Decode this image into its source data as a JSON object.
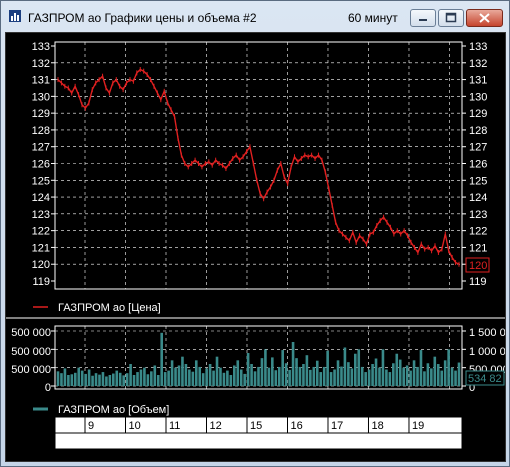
{
  "window": {
    "title": "ГАЗПРОМ ао Графики цены и объема #2",
    "interval": "60 минут"
  },
  "colors": {
    "price": "#e02020",
    "volume": "#3a8a8a",
    "grid": "#ffffff",
    "axis_text": "#ffffff"
  },
  "price_panel": {
    "legend": "ГАЗПРОМ ао [Цена]",
    "last_price_label": "120"
  },
  "volume_panel": {
    "legend": "ГАЗПРОМ ао [Объем]",
    "left_labels": [
      "500 000",
      "500 000",
      "500 000",
      "0"
    ],
    "right_labels": [
      "1 500 000",
      "1 000 000",
      "500 000",
      "0"
    ],
    "last_volume_label": "534 82"
  },
  "time_axis": {
    "labels": [
      "9",
      "10",
      "11",
      "12",
      "15",
      "16",
      "17",
      "18",
      "19"
    ]
  },
  "chart_data": {
    "type": "line",
    "title": "",
    "series": [
      {
        "name": "ГАЗПРОМ ао [Цена]",
        "values": [
          131,
          130.8,
          130.6,
          130.5,
          130.2,
          130.6,
          130.1,
          129.5,
          129.3,
          129.6,
          130.4,
          130.8,
          131,
          131.2,
          130.5,
          130.2,
          130.8,
          131,
          130.6,
          130.4,
          130.8,
          131,
          130.9,
          131.4,
          131.6,
          131.5,
          131.3,
          131,
          130.6,
          130.2,
          129.8,
          130.3,
          129.6,
          129.2,
          128.8,
          127.5,
          126.5,
          126,
          125.8,
          126,
          126.2,
          126,
          125.8,
          126,
          126.1,
          125.9,
          126.2,
          126,
          125.9,
          125.7,
          126,
          126.3,
          126.5,
          126.2,
          126.4,
          126.7,
          127,
          126,
          125,
          124.2,
          123.9,
          124.3,
          124.6,
          125,
          125.6,
          126,
          125.2,
          124.8,
          125.8,
          126.4,
          126.1,
          126.3,
          126.5,
          126.4,
          126.5,
          126.3,
          126.5,
          126.2,
          125.5,
          124.5,
          123.5,
          122.5,
          122,
          121.8,
          121.6,
          121.4,
          121.9,
          121.3,
          121.7,
          121.5,
          121.2,
          121.8,
          121.9,
          122.3,
          122.6,
          122.8,
          122.5,
          122.2,
          121.8,
          122,
          121.8,
          122,
          121.7,
          121.3,
          121,
          120.7,
          121.2,
          120.9,
          121,
          120.8,
          121.1,
          120.7,
          120.9,
          121.8,
          120.8,
          120.4,
          120.1,
          120
        ]
      }
    ],
    "volume": [
      400000,
      350000,
      480000,
      300000,
      320000,
      360000,
      500000,
      420000,
      330000,
      450000,
      280000,
      350000,
      310000,
      380000,
      260000,
      300000,
      340000,
      420000,
      360000,
      290000,
      350000,
      600000,
      300000,
      380000,
      450000,
      500000,
      320000,
      400000,
      560000,
      300000,
      1450000,
      380000,
      420000,
      700000,
      500000,
      560000,
      800000,
      600000,
      450000,
      390000,
      700000,
      520000,
      350000,
      480000,
      600000,
      420000,
      800000,
      500000,
      360000,
      420000,
      300000,
      560000,
      700000,
      450000,
      330000,
      900000,
      600000,
      400000,
      520000,
      760000,
      1000000,
      500000,
      780000,
      430000,
      520000,
      980000,
      620000,
      440000,
      1200000,
      760000,
      520000,
      600000,
      840000,
      440000,
      520000,
      690000,
      380000,
      520000,
      960000,
      380000,
      450000,
      700000,
      530000,
      1050000,
      650000,
      480000,
      880000,
      1000000,
      520000,
      380000,
      450000,
      600000,
      750000,
      500000,
      1000000,
      450000,
      380000,
      620000,
      880000,
      720000,
      500000,
      560000,
      420000,
      700000,
      520000,
      980000,
      400000,
      620000,
      480000,
      800000,
      600000,
      420000,
      700000,
      1000000,
      500000,
      420000,
      640000
    ],
    "y_ticks": [
      133,
      132,
      131,
      130,
      129,
      128,
      127,
      126,
      125,
      124,
      123,
      122,
      121,
      120,
      119
    ],
    "ylim": [
      119,
      133
    ],
    "volume_ylim": [
      0,
      1500000
    ],
    "grid": true
  }
}
